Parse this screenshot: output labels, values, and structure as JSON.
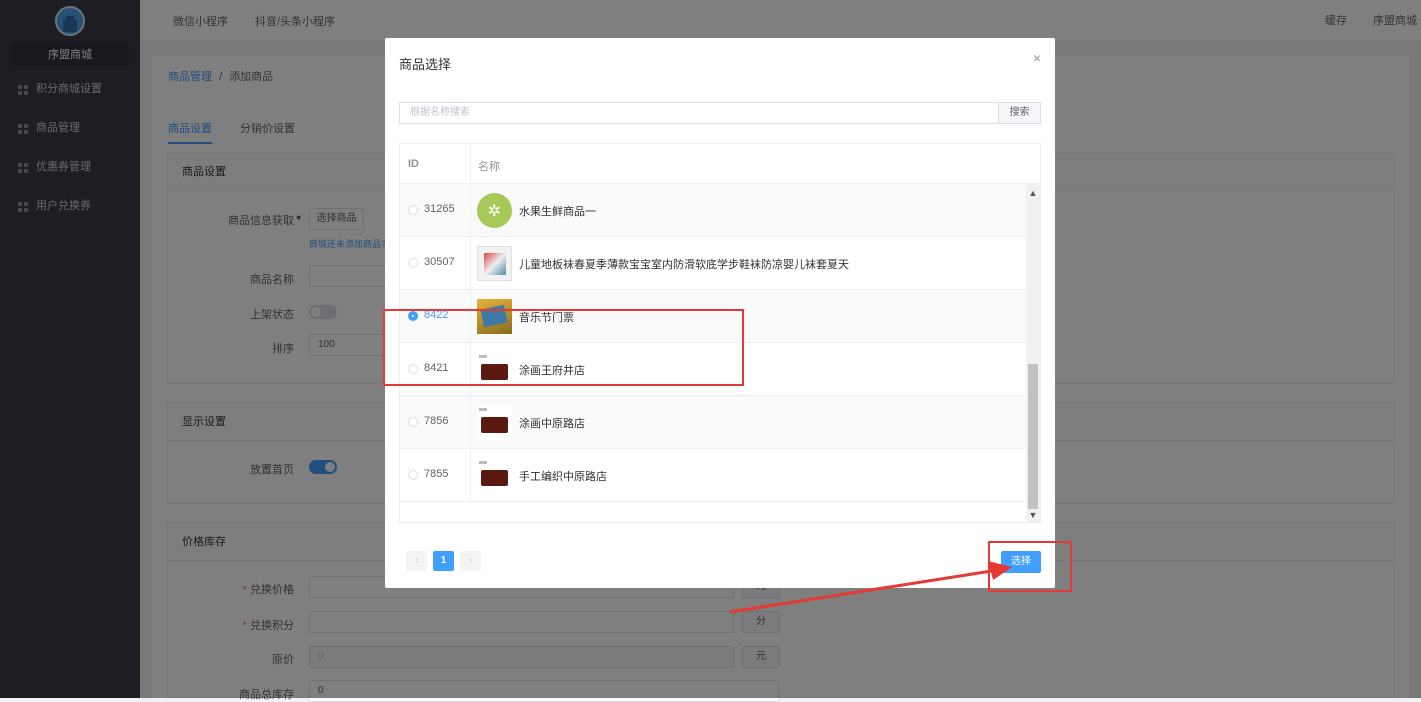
{
  "sidebar": {
    "brand": "序盟商城",
    "items": [
      {
        "label": "积分商城设置"
      },
      {
        "label": "商品管理"
      },
      {
        "label": "优惠券管理"
      },
      {
        "label": "用户兑换券"
      }
    ]
  },
  "topbar": {
    "tabs": [
      "微信小程序",
      "抖音/头条小程序"
    ],
    "right": [
      "缓存",
      "序盟商城"
    ]
  },
  "breadcrumb": {
    "parent": "商品管理",
    "sep": "/",
    "current": "添加商品"
  },
  "tabs": [
    "商品设置",
    "分销价设置"
  ],
  "goods_settings": {
    "header": "商品设置",
    "info_label": "商品信息获取",
    "choose_btn": "选择商品",
    "hint": "商城还未添加商品?",
    "name_label": "商品名称",
    "status_label": "上架状态",
    "sort_label": "排序",
    "sort_value": "100"
  },
  "display_settings": {
    "header": "显示设置",
    "home_label": "放置首页"
  },
  "price_stock": {
    "header": "价格库存",
    "price_label": "兑换价格",
    "price_unit": "元",
    "points_label": "兑换积分",
    "points_unit": "分",
    "orig_label": "原价",
    "orig_value": "0",
    "orig_unit": "元",
    "stock_label": "商品总库存",
    "stock_value": "0"
  },
  "modal": {
    "title": "商品选择",
    "close": "×",
    "search_placeholder": "根据名称搜索",
    "search_btn": "搜索",
    "col_id": "ID",
    "col_name": "名称",
    "rows": [
      {
        "id": "31265",
        "name": "水果生鲜商品一",
        "thumb": "leaf",
        "selected": false
      },
      {
        "id": "30507",
        "name": "儿童地板袜春夏季薄款宝宝室内防滑软底学步鞋袜防凉婴儿袜套夏天",
        "thumb": "sock",
        "selected": false
      },
      {
        "id": "8422",
        "name": "音乐节门票",
        "thumb": "ticket",
        "selected": true
      },
      {
        "id": "8421",
        "name": "涂画王府井店",
        "thumb": "bag",
        "selected": false
      },
      {
        "id": "7856",
        "name": "涂画中原路店",
        "thumb": "bag",
        "selected": false
      },
      {
        "id": "7855",
        "name": "手工编织中原路店",
        "thumb": "bag",
        "selected": false
      }
    ],
    "page": "1",
    "select_btn": "选择"
  },
  "colors": {
    "accent": "#409eff",
    "highlight": "#e53935"
  }
}
